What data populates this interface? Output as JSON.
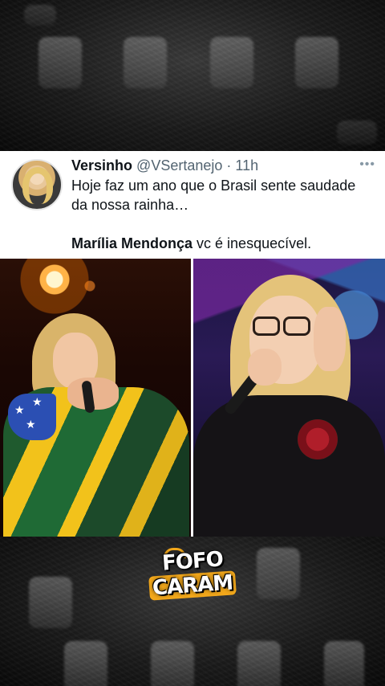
{
  "tweet": {
    "author_name": "Versinho",
    "author_handle": "@VSertanejo",
    "separator": "·",
    "time": "11h",
    "more_icon": "more-horizontal-icon",
    "line1": "Hoje faz um ano que o Brasil sente saudade",
    "line2": "da nossa rainha…",
    "highlight_name": "Marília Mendonça",
    "line3_rest": " vc é inesquecível."
  },
  "logo": {
    "line1": "FOFO",
    "line2": "CARAM"
  },
  "colors": {
    "card_bg": "#ffffff",
    "text_primary": "#0f1419",
    "text_secondary": "#536471",
    "logo_accent": "#f3a81b"
  }
}
